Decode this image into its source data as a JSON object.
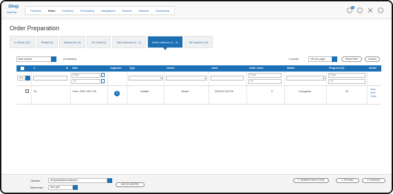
{
  "brand": {
    "line1": "Shop",
    "line2": "myshop"
  },
  "nav": [
    {
      "label": "Products"
    },
    {
      "label": "Sales"
    },
    {
      "label": "Inventory"
    },
    {
      "label": "Purchasing"
    },
    {
      "label": "Integrations"
    },
    {
      "label": "Reports"
    },
    {
      "label": "Wizards"
    },
    {
      "label": "Accounting"
    }
  ],
  "top": {
    "notif_count": "10"
  },
  "page_title": "Order Preparation",
  "tabs": [
    {
      "label": "In Stock (14)"
    },
    {
      "label": "Partial (0)"
    },
    {
      "label": "Backorder (2)"
    },
    {
      "label": "On Hold (0)"
    },
    {
      "label": "New batches (0 - 0)"
    },
    {
      "label": "Active batches (1 - 2)"
    },
    {
      "label": "All batches (10)"
    }
  ],
  "toolbar": {
    "bulk_actions": "Bulk actions",
    "selected": "(0 selected)",
    "records": "1 records",
    "per_page": "100 per page",
    "reset_filter": "Reset Filter",
    "search": "Search"
  },
  "columns": [
    "",
    "#",
    "Date",
    "Organizer",
    "Type",
    "Carrier",
    "Label",
    "Order count",
    "Status",
    "Progress (%)",
    "Action"
  ],
  "filters": {
    "any": "Any",
    "from": "From",
    "to": "To"
  },
  "rows": [
    {
      "id": "16",
      "date": "2 févr. 2022, 05:17:29",
      "type": "multiple",
      "carrier": "Boxtal",
      "label": "2022110 187729",
      "order_count": "3",
      "status": "In progress",
      "progress": "33",
      "actions": [
        "View",
        "Print",
        "Close"
      ]
    }
  ],
  "footer": {
    "operator_label": "Operator:",
    "operator_value": "armparato@lovemyshop.fr",
    "warehouse_label": "Warehouse:",
    "warehouse_value": "New york",
    "batch_helper": "BATCH HELPER",
    "steps": [
      "1. ORDERS SELECTION",
      "2. PICKING",
      "3. PACKING"
    ]
  },
  "colors": {
    "accent": "#1b6fb5"
  }
}
